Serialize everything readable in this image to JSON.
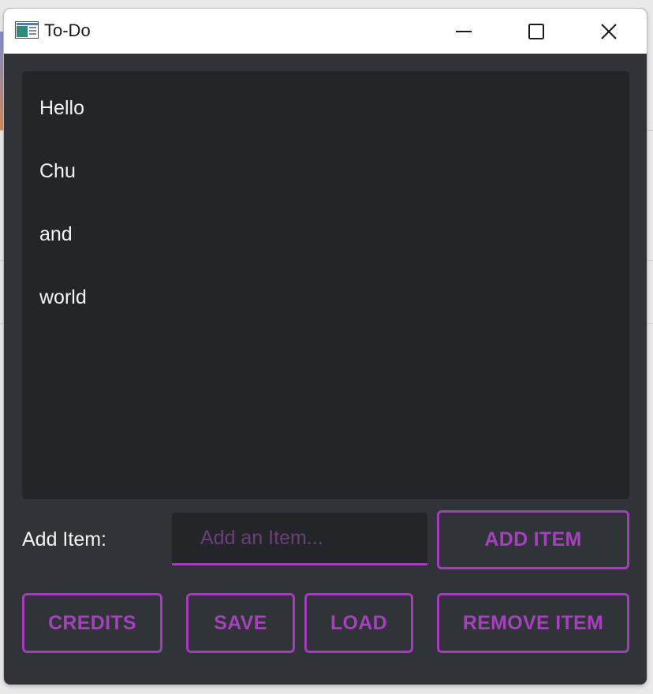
{
  "window": {
    "title": "To-Do",
    "icons": {
      "app": "app-window-icon",
      "minimize": "minimize-icon",
      "maximize": "maximize-icon",
      "close": "close-icon"
    }
  },
  "todo_list": {
    "items": [
      "Hello",
      "Chu",
      "and",
      "world"
    ]
  },
  "add_form": {
    "label": "Add Item:",
    "input_value": "",
    "input_placeholder": "Add an Item...",
    "add_button": "ADD ITEM"
  },
  "actions": {
    "credits": "CREDITS",
    "save": "SAVE",
    "load": "LOAD",
    "remove": "REMOVE ITEM"
  },
  "colors": {
    "accent": "#a541bd",
    "background": "#303337",
    "panel": "#232528",
    "text": "#f3f3f3"
  }
}
